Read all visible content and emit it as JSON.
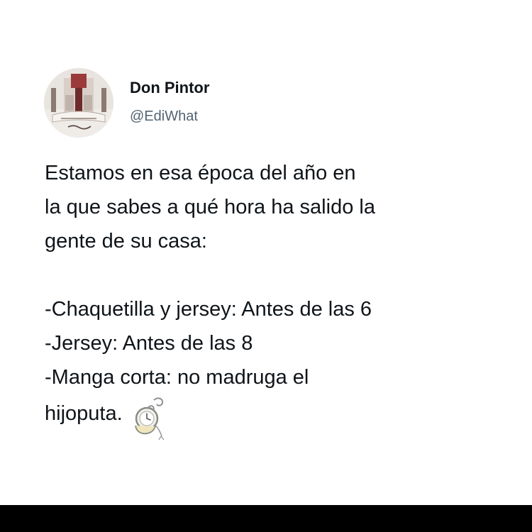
{
  "tweet": {
    "author": {
      "display_name": "Don Pintor",
      "handle": "@EdiWhat"
    },
    "text": {
      "line_1": "Estamos en esa época del año en",
      "line_2": "la que sabes a qué hora ha salido la",
      "line_3": "gente de su casa:",
      "line_4": "-Chaquetilla y jersey: Antes de las 6",
      "line_5": "-Jersey: Antes de las 8",
      "line_6": "-Manga corta: no madruga el",
      "line_7": "hijoputa."
    },
    "emoji_icon": "pocket-watch-icon"
  },
  "colors": {
    "background": "#ffffff",
    "text": "#0f1419",
    "secondary_text": "#536471",
    "bottom_bar": "#000000"
  }
}
